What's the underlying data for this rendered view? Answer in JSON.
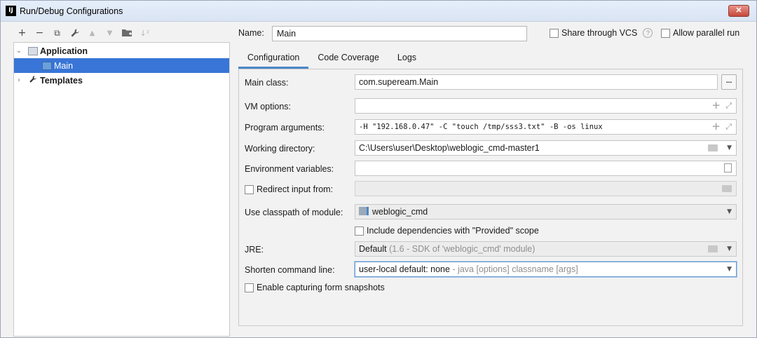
{
  "window": {
    "title": "Run/Debug Configurations",
    "app_icon": "IJ",
    "close_label": "✕"
  },
  "left_panel": {
    "toolbar": [
      {
        "icon": "add-icon",
        "glyph": "+"
      },
      {
        "icon": "remove-icon",
        "glyph": "−"
      },
      {
        "icon": "copy-icon",
        "glyph": "⧉"
      },
      {
        "icon": "wrench-icon",
        "glyph": "🔧"
      },
      {
        "icon": "move-up-icon",
        "glyph": "▲"
      },
      {
        "icon": "move-down-icon",
        "glyph": "▼"
      },
      {
        "icon": "folder-icon",
        "glyph": "▰"
      },
      {
        "icon": "sort-icon",
        "glyph": "↓"
      }
    ],
    "tree": {
      "application": "Application",
      "main": "Main",
      "templates": "Templates"
    }
  },
  "name_field": {
    "label": "Name:",
    "value": "Main"
  },
  "share_vcs": {
    "label": "Share through VCS"
  },
  "allow_parallel": {
    "label": "Allow parallel run"
  },
  "tabs": [
    "Configuration",
    "Code Coverage",
    "Logs"
  ],
  "config": {
    "main_class": {
      "label": "Main class:",
      "value": "com.supeream.Main",
      "button": "..."
    },
    "vm_options": {
      "label": "VM options:",
      "value": ""
    },
    "program_args": {
      "label": "Program arguments:",
      "value": "-H \"192.168.0.47\" -C \"touch /tmp/sss3.txt\" -B -os linux"
    },
    "working_dir": {
      "label": "Working directory:",
      "value": "C:\\Users\\user\\Desktop\\weblogic_cmd-master1"
    },
    "env_vars": {
      "label": "Environment variables:",
      "value": ""
    },
    "redirect_input": {
      "label": "Redirect input from:"
    },
    "classpath_module": {
      "label": "Use classpath of module:",
      "value": "weblogic_cmd"
    },
    "include_deps": {
      "label": "Include dependencies with \"Provided\" scope"
    },
    "jre": {
      "label": "JRE:",
      "value": "Default",
      "detail": "(1.6 - SDK of 'weblogic_cmd' module)"
    },
    "shorten_cmd": {
      "label": "Shorten command line:",
      "value": "user-local default: none",
      "detail": "- java [options] classname [args]"
    },
    "enable_snapshots": {
      "label": "Enable capturing form snapshots"
    }
  },
  "colors": {
    "selection": "#3875d7",
    "tab_underline": "#4a88c7",
    "title_bar": "#dfe8f6"
  }
}
